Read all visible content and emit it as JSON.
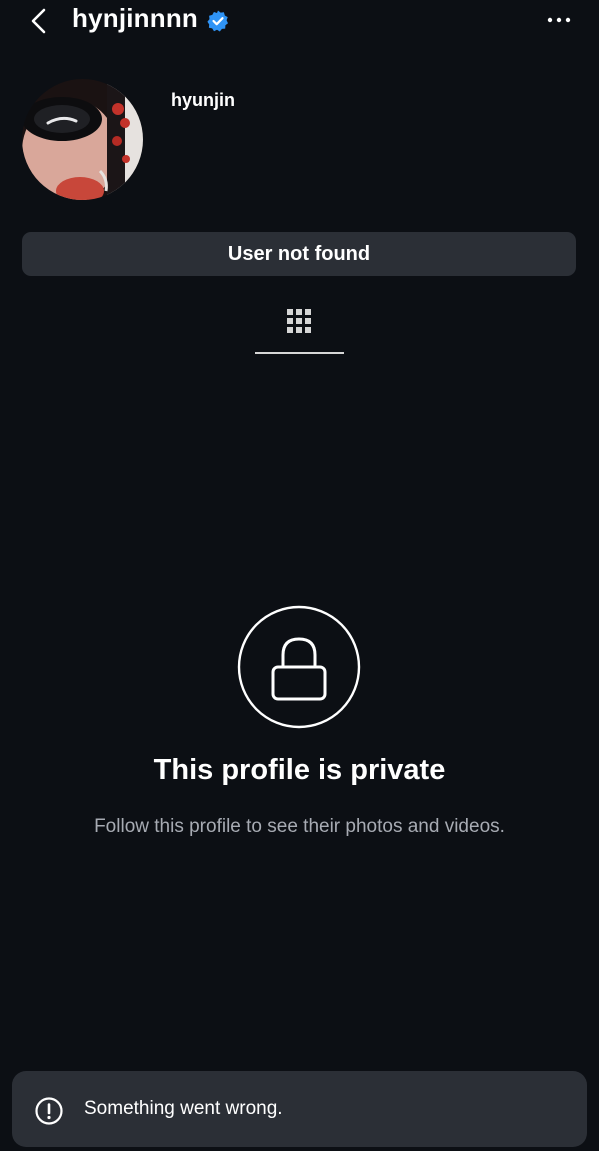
{
  "header": {
    "username": "hynjinnnn",
    "icons": {
      "back": "chevron-left-icon",
      "verified": "verified-badge-icon",
      "more": "more-horizontal-icon"
    }
  },
  "profile": {
    "display_name": "hyunjin"
  },
  "status": {
    "text": "User not found"
  },
  "tabs": [
    {
      "icon": "grid-icon",
      "active": true
    }
  ],
  "private_notice": {
    "icon": "lock-icon",
    "title": "This profile is private",
    "subtitle": "Follow this profile to see their photos and videos."
  },
  "toast": {
    "icon": "alert-circle-icon",
    "message": "Something went wrong."
  },
  "colors": {
    "background": "#0c0f14",
    "surface": "#2b2f36",
    "text": "#ffffff",
    "muted_text": "#a7abb3",
    "verified_blue": "#2f93f5"
  }
}
